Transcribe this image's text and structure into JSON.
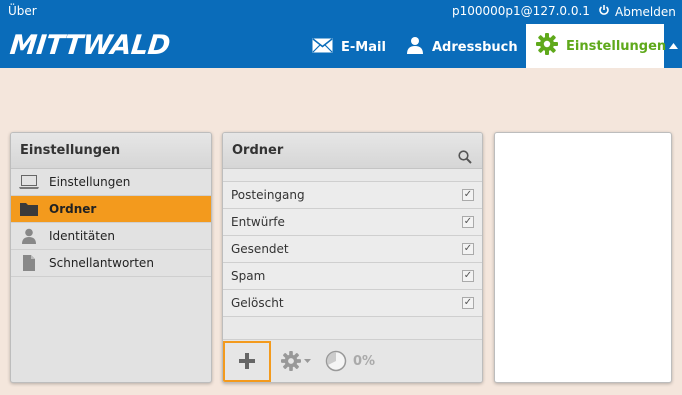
{
  "header": {
    "about": "Über",
    "user": "p100000p1@127.0.0.1",
    "logout": "Abmelden",
    "logo": "MITTWALD",
    "tabs": [
      {
        "label": "E-Mail",
        "icon": "mail-icon"
      },
      {
        "label": "Adressbuch",
        "icon": "contact-icon"
      },
      {
        "label": "Einstellungen",
        "icon": "gear-icon"
      }
    ]
  },
  "settings_panel": {
    "title": "Einstellungen",
    "items": [
      {
        "label": "Einstellungen",
        "icon": "laptop-icon"
      },
      {
        "label": "Ordner",
        "icon": "folder-icon"
      },
      {
        "label": "Identitäten",
        "icon": "person-icon"
      },
      {
        "label": "Schnellantworten",
        "icon": "document-icon"
      }
    ],
    "active_index": 1
  },
  "folders_panel": {
    "title": "Ordner",
    "folders": [
      {
        "name": "Posteingang",
        "subscribed": true
      },
      {
        "name": "Entwürfe",
        "subscribed": true
      },
      {
        "name": "Gesendet",
        "subscribed": true
      },
      {
        "name": "Spam",
        "subscribed": true
      },
      {
        "name": "Gelöscht",
        "subscribed": true
      }
    ],
    "quota": "0%"
  },
  "colors": {
    "header_blue": "#0a6cba",
    "active_orange": "#f39a1d",
    "settings_green": "#5fa91b",
    "background": "#f4e6dc"
  }
}
